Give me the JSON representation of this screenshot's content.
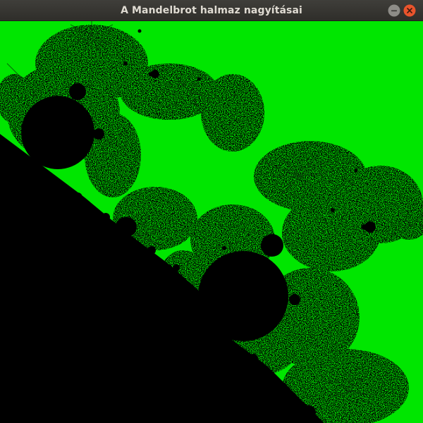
{
  "window": {
    "title": "A Mandelbrot halmaz nagyításai"
  },
  "controls": {
    "minimize_icon": "minimize-icon",
    "close_icon": "close-icon"
  },
  "colors": {
    "titlebar": "#383733",
    "title_text": "#dfdbd2",
    "minimize_button": "#8d8c87",
    "close_button": "#e9542c",
    "fractal_background": "#00e600",
    "fractal_set": "#000000"
  }
}
